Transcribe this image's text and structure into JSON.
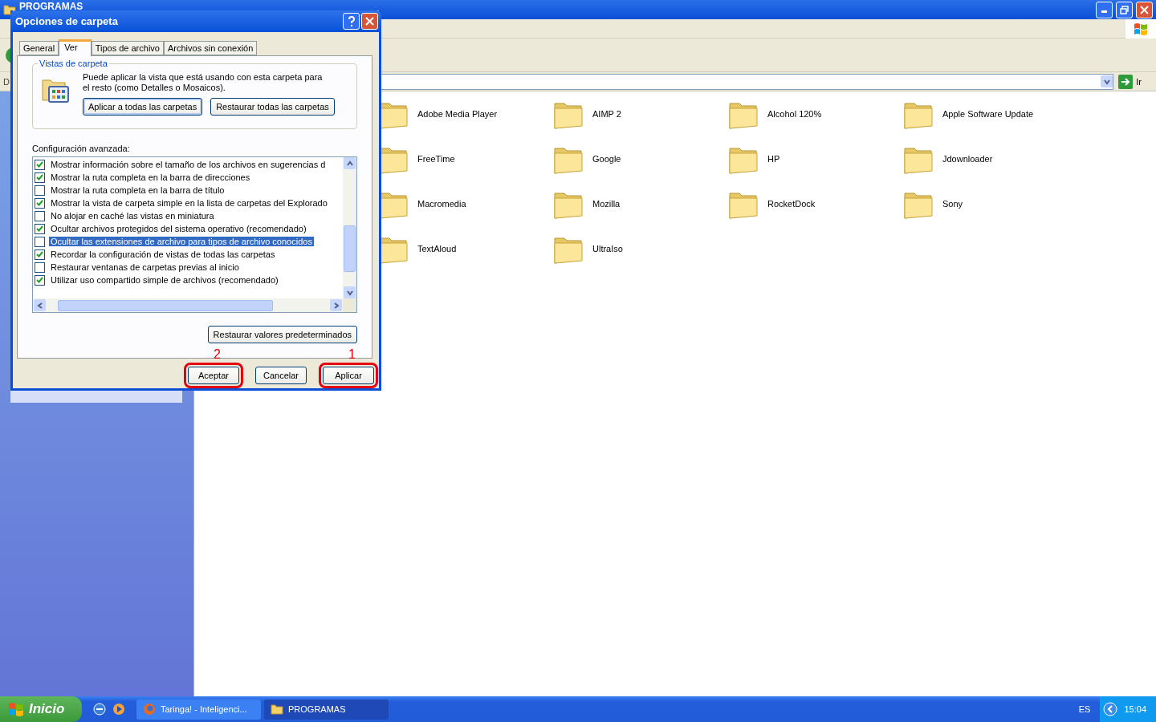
{
  "explorer": {
    "title": "PROGRAMAS",
    "address_label": "D",
    "go_label": "Ir",
    "folders": [
      "Adobe Media Player",
      "AIMP 2",
      "Alcohol 120%",
      "Apple Software Update",
      "FreeTime",
      "Google",
      "HP",
      "Jdownloader",
      "Macromedia",
      "Mozilla",
      "RocketDock",
      "Sony",
      "TextAloud",
      "UltraIso"
    ]
  },
  "dialog": {
    "title": "Opciones de carpeta",
    "tabs": [
      {
        "label": "General",
        "selected": false
      },
      {
        "label": "Ver",
        "selected": true
      },
      {
        "label": "Tipos de archivo",
        "selected": false
      },
      {
        "label": "Archivos sin conexión",
        "selected": false
      }
    ],
    "group": {
      "title": "Vistas de carpeta",
      "text": "Puede aplicar la vista que está usando con esta carpeta para el resto (como Detalles o Mosaicos).",
      "buttons": [
        "Aplicar a todas las carpetas",
        "Restaurar todas las carpetas"
      ]
    },
    "advanced_label": "Configuración avanzada:",
    "settings": [
      {
        "label": "Mostrar información sobre el tamaño de los archivos en sugerencias d",
        "checked": true,
        "selected": false
      },
      {
        "label": "Mostrar la ruta completa en la barra de direcciones",
        "checked": true,
        "selected": false
      },
      {
        "label": "Mostrar la ruta completa en la barra de título",
        "checked": false,
        "selected": false
      },
      {
        "label": "Mostrar la vista de carpeta simple en la lista de carpetas del Explorado",
        "checked": true,
        "selected": false
      },
      {
        "label": "No alojar en caché las vistas en miniatura",
        "checked": false,
        "selected": false
      },
      {
        "label": "Ocultar archivos protegidos del sistema operativo (recomendado)",
        "checked": true,
        "selected": false
      },
      {
        "label": "Ocultar las extensiones de archivo para tipos de archivo conocidos",
        "checked": false,
        "selected": true
      },
      {
        "label": "Recordar la configuración de vistas de todas las carpetas",
        "checked": true,
        "selected": false
      },
      {
        "label": "Restaurar ventanas de carpetas previas al inicio",
        "checked": false,
        "selected": false
      },
      {
        "label": "Utilizar uso compartido simple de archivos (recomendado)",
        "checked": true,
        "selected": false
      }
    ],
    "restore_button": "Restaurar valores predeterminados",
    "buttons": [
      {
        "label": "Aceptar",
        "annotation": "2"
      },
      {
        "label": "Cancelar"
      },
      {
        "label": "Aplicar",
        "annotation": "1"
      }
    ]
  },
  "taskbar": {
    "start": "Inicio",
    "tasks": [
      {
        "label": "Taringa! - Inteligenci...",
        "kind": "browser",
        "selected": false
      },
      {
        "label": "PROGRAMAS",
        "kind": "folder",
        "selected": true
      }
    ],
    "language": "ES",
    "clock": "15:04"
  }
}
